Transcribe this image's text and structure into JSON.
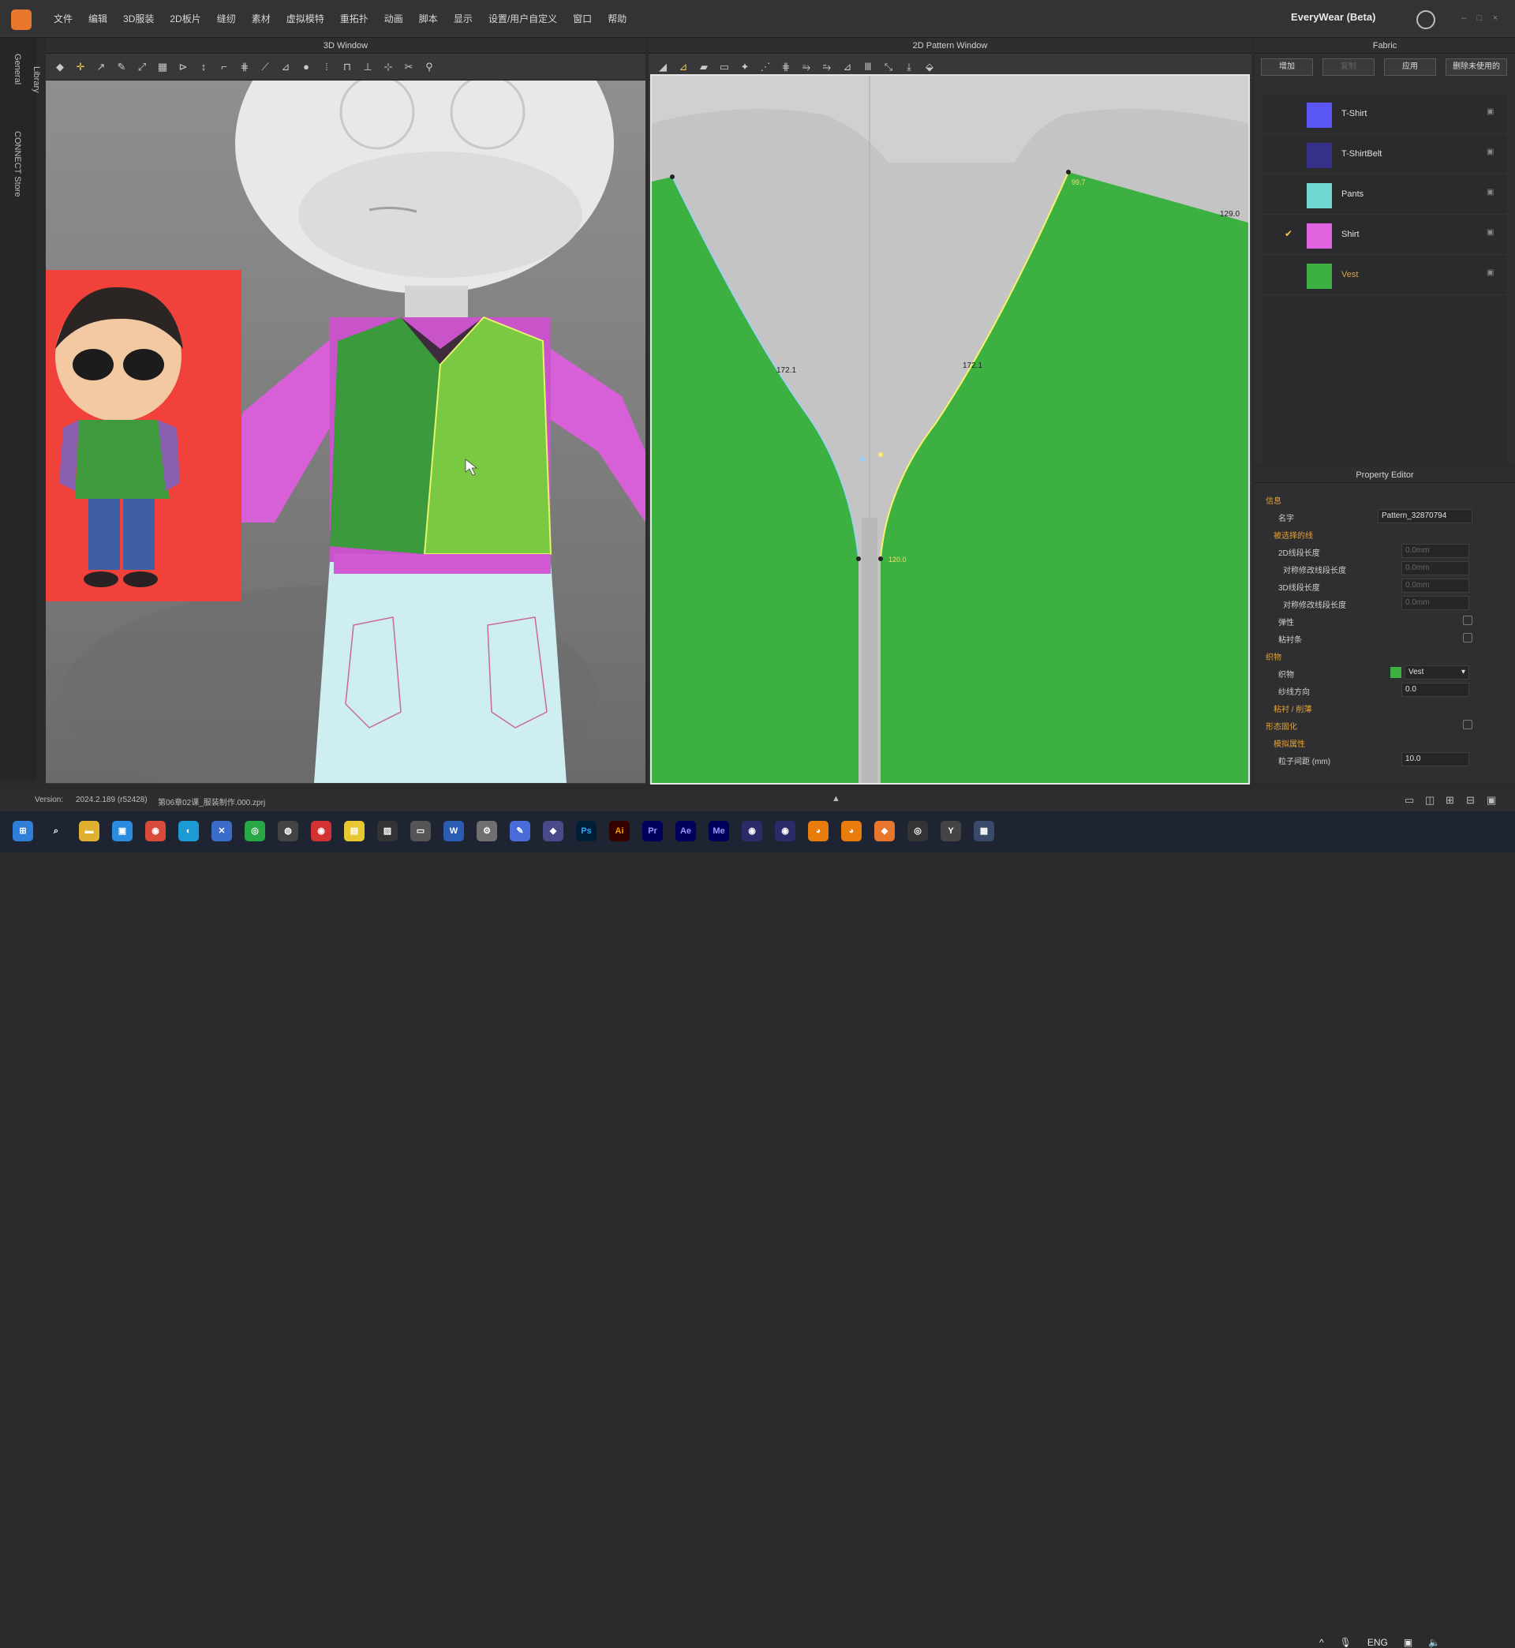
{
  "menu": [
    "文件",
    "编辑",
    "3D服装",
    "2D板片",
    "缝纫",
    "素材",
    "虚拟模特",
    "重拓扑",
    "动画",
    "脚本",
    "显示",
    "设置/用户自定义",
    "窗口",
    "帮助"
  ],
  "app_name": "EveryWear (Beta)",
  "left_rail": {
    "tab_general": "General",
    "tab_library": "Library",
    "tab_store": "CONNECT Store"
  },
  "window3d": {
    "title": "3D Window"
  },
  "window2d": {
    "title": "2D Pattern Window",
    "measurements": [
      "172.1",
      "172.1",
      "129.0",
      "99.7",
      "120.0"
    ]
  },
  "fabric_panel": {
    "title": "Fabric",
    "buttons": [
      "增加",
      "复制",
      "应用",
      "删除未使用的"
    ],
    "items": [
      {
        "name": "T-Shirt",
        "color": "#5b57f5",
        "checked": false
      },
      {
        "name": "T-ShirtBelt",
        "color": "#363088",
        "checked": false
      },
      {
        "name": "Pants",
        "color": "#6fd8d3",
        "checked": false
      },
      {
        "name": "Shirt",
        "color": "#e163df",
        "checked": true
      },
      {
        "name": "Vest",
        "color": "#3db042",
        "checked": false
      }
    ]
  },
  "property_editor": {
    "title": "Property Editor",
    "section_info": "信息",
    "name_label": "名字",
    "name_value": "Pattern_32870794",
    "section_selected_line": "被选择的线",
    "line2d_label": "2D线段长度",
    "line2d_value": "0.0mm",
    "sym2d_label": "对称修改线段长度",
    "sym2d_value": "0.0mm",
    "line3d_label": "3D线段长度",
    "line3d_value": "0.0mm",
    "sym3d_label": "对称修改线段长度",
    "sym3d_value": "0.0mm",
    "elastic_label": "弹性",
    "tape_label": "粘衬条",
    "section_fabric": "织物",
    "fabric_label": "织物",
    "fabric_value": "Vest",
    "grain_label": "纱线方向",
    "grain_value": "0.0",
    "section_fuse": "粘衬 / 削薄",
    "section_shape": "形态固化",
    "section_sim": "模拟属性",
    "particle_label": "粒子间距 (mm)",
    "particle_value": "10.0"
  },
  "status": {
    "version_label": "Version:",
    "version": "2024.2.189 (r52428)",
    "file": "第06章02课_服装制作.000.zprj"
  },
  "taskbar": {
    "apps": [
      "Ps",
      "Ai",
      "Pr",
      "Ae",
      "Me",
      "Y"
    ],
    "lang": "ENG"
  },
  "colors": {
    "vest_green": "#3db042",
    "vest_selected": "#7ac943",
    "shirt_pink": "#d75fd8",
    "pants_blue": "#cfeef2",
    "accent_orange": "#e0a23c"
  }
}
